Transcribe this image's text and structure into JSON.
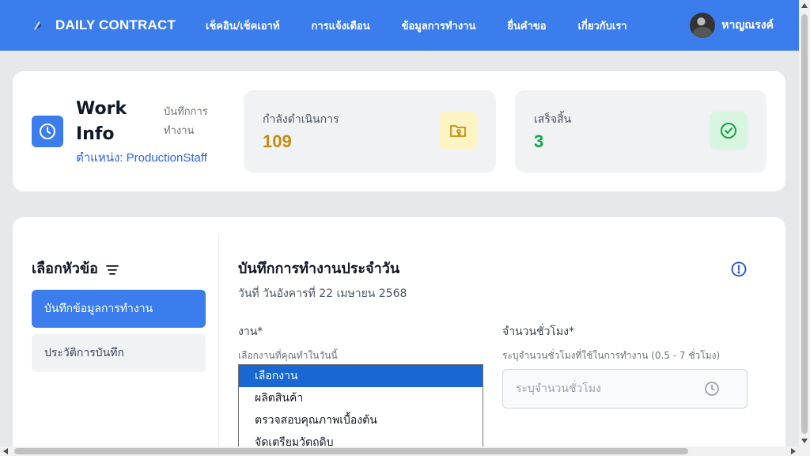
{
  "navbar": {
    "brand": "DAILY CONTRACT",
    "links": [
      "เช็คอิน/เช็คเอาท์",
      "การแจ้งเตือน",
      "ข้อมูลการทำงาน",
      "ยื่นคำขอ",
      "เกี่ยวกับเรา"
    ],
    "user_name": "หาญณรงค์"
  },
  "info": {
    "title": "Work Info",
    "subtitle": "บันทึกการทำงาน",
    "position": "ตำแหน่ง: ProductionStaff",
    "stats": [
      {
        "label": "กำลังดำเนินการ",
        "value": "109",
        "icon": "folder-key-icon",
        "color": "#c98a12"
      },
      {
        "label": "เสร็จสิ้น",
        "value": "3",
        "icon": "check-circle-icon",
        "color": "#16a34a"
      }
    ]
  },
  "sidebar": {
    "title": "เลือกหัวข้อ",
    "items": [
      "บันทึกข้อมูลการทำงาน",
      "ประวัติการบันทึก"
    ],
    "active_index": 0
  },
  "form": {
    "title": "บันทึกการทำงานประจำวัน",
    "date": "วันที่ วันอังคารที่ 22 เมษายน 2568",
    "job_label": "งาน*",
    "job_help": "เลือกงานที่คุณทำในวันนี้",
    "hours_label": "จำนวนชั่วโมง*",
    "hours_help": "ระบุจำนวนชั่วโมงที่ใช้ในการทำงาน (0.5 - 7 ชั่วโมง)",
    "hours_placeholder": "ระบุจำนวนชั่วโมง",
    "job_options": [
      "เลือกงาน",
      "ผลิตสินค้า",
      "ตรวจสอบคุณภาพเบื้องต้น",
      "จัดเตรียมวัตถุดิบ"
    ],
    "job_selected_index": 0
  },
  "colors": {
    "primary": "#3b7ded",
    "in_progress": "#c98a12",
    "done": "#16a34a"
  }
}
